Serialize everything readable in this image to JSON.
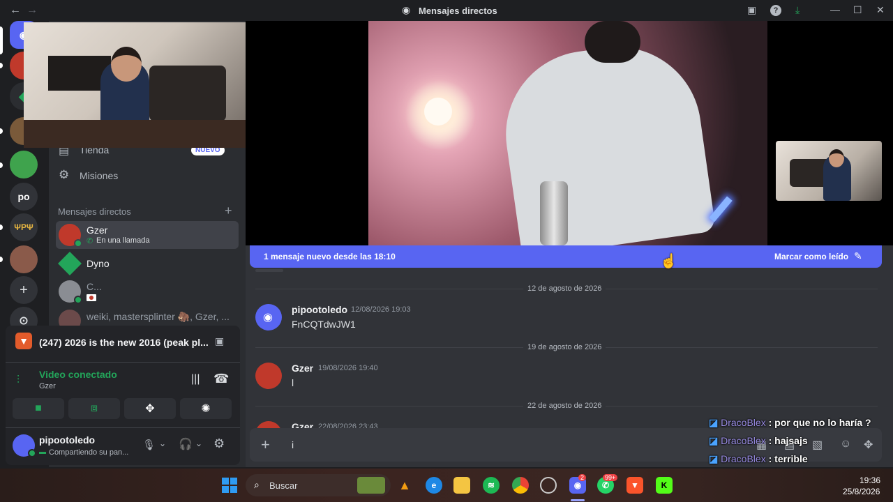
{
  "titlebar": {
    "title": "Mensajes directos"
  },
  "rail": {
    "server_labels": [
      "po",
      "ΨPΨ"
    ]
  },
  "sidebar": {
    "shop_label": "Tienda",
    "shop_badge": "NUEVO",
    "missions_label": "Misiones",
    "dm_header": "Mensajes directos",
    "add_dm": "+",
    "dms": [
      {
        "name": "Gzer",
        "status": "En una llamada"
      },
      {
        "name": "Dyno"
      },
      {
        "name": "C..."
      },
      {
        "name": "weiki, mastersplinter 🦣, Gzer, ..."
      }
    ]
  },
  "activity": {
    "title": "(247) 2026 is the new 2016 (peak pl..."
  },
  "voice": {
    "status": "Video conectado",
    "channel": "Gzer"
  },
  "user": {
    "name": "pipootoledo",
    "status": "Compartiendo su pan..."
  },
  "chat": {
    "new_messages": "1 mensaje nuevo desde las 18:10",
    "mark_read": "Marcar como leído",
    "dates": [
      "12 de agosto de 2026",
      "19 de agosto de 2026",
      "22 de agosto de 2026"
    ],
    "messages": [
      {
        "author": "pipootoledo",
        "time": "12/08/2026 19:03",
        "text": "FnCQTdwJW1"
      },
      {
        "author": "Gzer",
        "time": "19/08/2026 19:40",
        "text": "l"
      },
      {
        "author": "Gzer",
        "time": "22/08/2026 23:43",
        "text": ""
      }
    ],
    "composer_value": "i"
  },
  "overlay": [
    {
      "name": "DracoBlex",
      "text": ": por que no lo haría ?"
    },
    {
      "name": "DracoBlex",
      "text": ": hajsajs"
    },
    {
      "name": "DracoBlex",
      "text": ": terrible"
    }
  ],
  "taskbar": {
    "search_placeholder": "Buscar",
    "discord_badge": "2",
    "whatsapp_badge": "99+",
    "time": "19:36",
    "date": "25/8/2026"
  },
  "colors": {
    "accent": "#5865f2",
    "green": "#23a55a",
    "bg": "#313338",
    "sidebar": "#2b2d31"
  }
}
